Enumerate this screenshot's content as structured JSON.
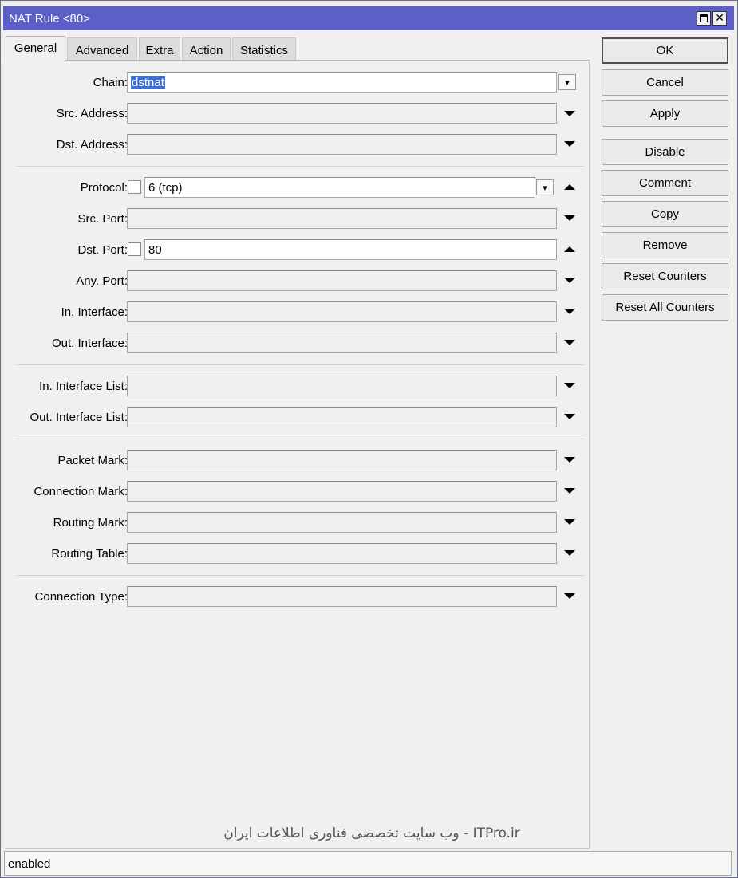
{
  "window": {
    "title": "NAT Rule <80>"
  },
  "tabs": [
    {
      "label": "General",
      "active": true
    },
    {
      "label": "Advanced",
      "active": false
    },
    {
      "label": "Extra",
      "active": false
    },
    {
      "label": "Action",
      "active": false
    },
    {
      "label": "Statistics",
      "active": false
    }
  ],
  "general": {
    "chain": {
      "label": "Chain:",
      "value": "dstnat"
    },
    "src_address": {
      "label": "Src. Address:",
      "value": ""
    },
    "dst_address": {
      "label": "Dst. Address:",
      "value": ""
    },
    "protocol": {
      "label": "Protocol:",
      "value": "6 (tcp)",
      "negate": false
    },
    "src_port": {
      "label": "Src. Port:",
      "value": ""
    },
    "dst_port": {
      "label": "Dst. Port:",
      "value": "80",
      "negate": false
    },
    "any_port": {
      "label": "Any. Port:",
      "value": ""
    },
    "in_interface": {
      "label": "In. Interface:",
      "value": ""
    },
    "out_interface": {
      "label": "Out. Interface:",
      "value": ""
    },
    "in_interface_list": {
      "label": "In. Interface List:",
      "value": ""
    },
    "out_interface_list": {
      "label": "Out. Interface List:",
      "value": ""
    },
    "packet_mark": {
      "label": "Packet Mark:",
      "value": ""
    },
    "connection_mark": {
      "label": "Connection Mark:",
      "value": ""
    },
    "routing_mark": {
      "label": "Routing Mark:",
      "value": ""
    },
    "routing_table": {
      "label": "Routing Table:",
      "value": ""
    },
    "connection_type": {
      "label": "Connection Type:",
      "value": ""
    }
  },
  "buttons": {
    "ok": "OK",
    "cancel": "Cancel",
    "apply": "Apply",
    "disable": "Disable",
    "comment": "Comment",
    "copy": "Copy",
    "remove": "Remove",
    "reset_counters": "Reset Counters",
    "reset_all_counters": "Reset All Counters"
  },
  "watermark": "ITPro.ir - وب سایت تخصصی فناوری اطلاعات ایران",
  "status": {
    "text": "enabled"
  },
  "colors": {
    "titlebar": "#5b5fc7",
    "selection": "#3d6fd2",
    "window_bg": "#f0f0f0"
  }
}
